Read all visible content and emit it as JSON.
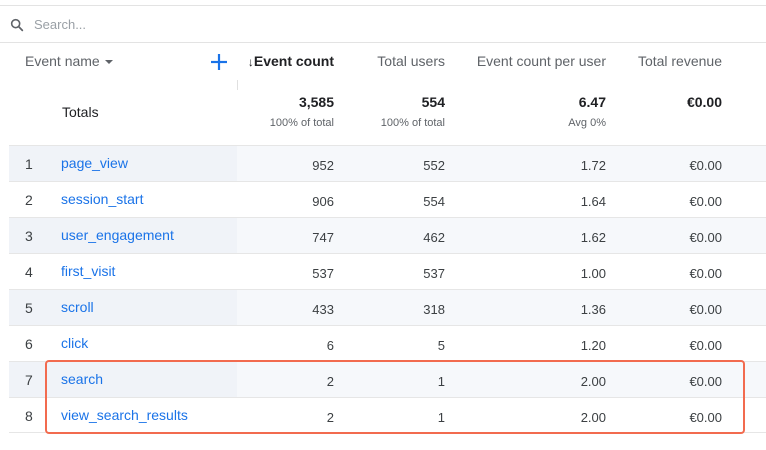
{
  "search": {
    "placeholder": "Search..."
  },
  "columns": {
    "dimension": "Event name",
    "event_count": "Event count",
    "total_users": "Total users",
    "event_count_per_user": "Event count per user",
    "total_revenue": "Total revenue"
  },
  "totals": {
    "label": "Totals",
    "event_count": "3,585",
    "event_count_sub": "100% of total",
    "total_users": "554",
    "total_users_sub": "100% of total",
    "event_count_per_user": "6.47",
    "event_count_per_user_sub": "Avg 0%",
    "total_revenue": "€0.00"
  },
  "rows": [
    {
      "index": "1",
      "name": "page_view",
      "event_count": "952",
      "total_users": "552",
      "per_user": "1.72",
      "revenue": "€0.00"
    },
    {
      "index": "2",
      "name": "session_start",
      "event_count": "906",
      "total_users": "554",
      "per_user": "1.64",
      "revenue": "€0.00"
    },
    {
      "index": "3",
      "name": "user_engagement",
      "event_count": "747",
      "total_users": "462",
      "per_user": "1.62",
      "revenue": "€0.00"
    },
    {
      "index": "4",
      "name": "first_visit",
      "event_count": "537",
      "total_users": "537",
      "per_user": "1.00",
      "revenue": "€0.00"
    },
    {
      "index": "5",
      "name": "scroll",
      "event_count": "433",
      "total_users": "318",
      "per_user": "1.36",
      "revenue": "€0.00"
    },
    {
      "index": "6",
      "name": "click",
      "event_count": "6",
      "total_users": "5",
      "per_user": "1.20",
      "revenue": "€0.00"
    },
    {
      "index": "7",
      "name": "search",
      "event_count": "2",
      "total_users": "1",
      "per_user": "2.00",
      "revenue": "€0.00"
    },
    {
      "index": "8",
      "name": "view_search_results",
      "event_count": "2",
      "total_users": "1",
      "per_user": "2.00",
      "revenue": "€0.00"
    }
  ],
  "colors": {
    "link": "#1a73e8",
    "highlight": "#f26b4f",
    "accent_plus": "#1a73e8"
  }
}
